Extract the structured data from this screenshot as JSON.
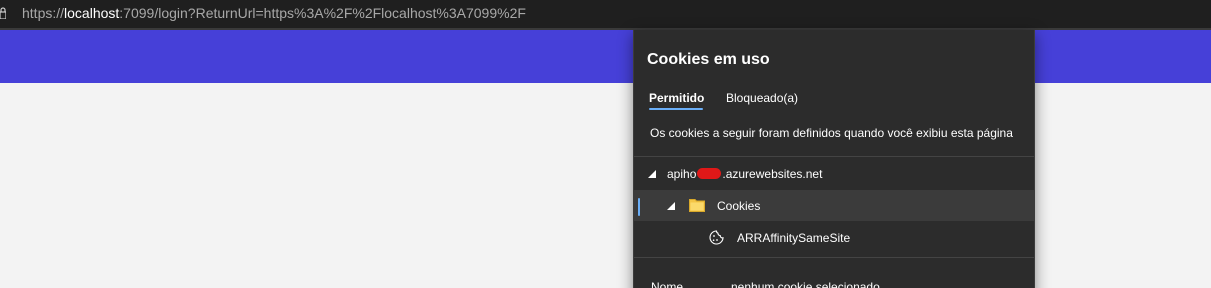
{
  "address_bar": {
    "url_prefix": "https://",
    "url_host": "localhost",
    "url_rest": ":7099/login?ReturnUrl=https%3A%2F%2Flocalhost%3A7099%2F"
  },
  "cookie_popup": {
    "title": "Cookies em uso",
    "tabs": [
      {
        "label": "Permitido",
        "selected": true
      },
      {
        "label": "Bloqueado(a)",
        "selected": false
      }
    ],
    "info_text": "Os cookies a seguir foram definidos quando você exibiu esta página",
    "tree": {
      "domain_prefix": "apiho",
      "domain_suffix": ".azurewebsites.net",
      "folder_label": "Cookies",
      "cookie_label": "ARRAffinitySameSite"
    },
    "details": {
      "name_label": "Nome",
      "name_value": "nenhum cookie selecionado"
    }
  },
  "colors": {
    "navbar": "#4640d8",
    "popup_background": "#2c2c2c",
    "accent": "#6aaef7",
    "redaction": "#e01818"
  },
  "icons": {
    "folder": "folder-icon",
    "cookie": "cookie-icon",
    "expand": "triangle-expanded-icon",
    "lock": "lock-icon"
  }
}
